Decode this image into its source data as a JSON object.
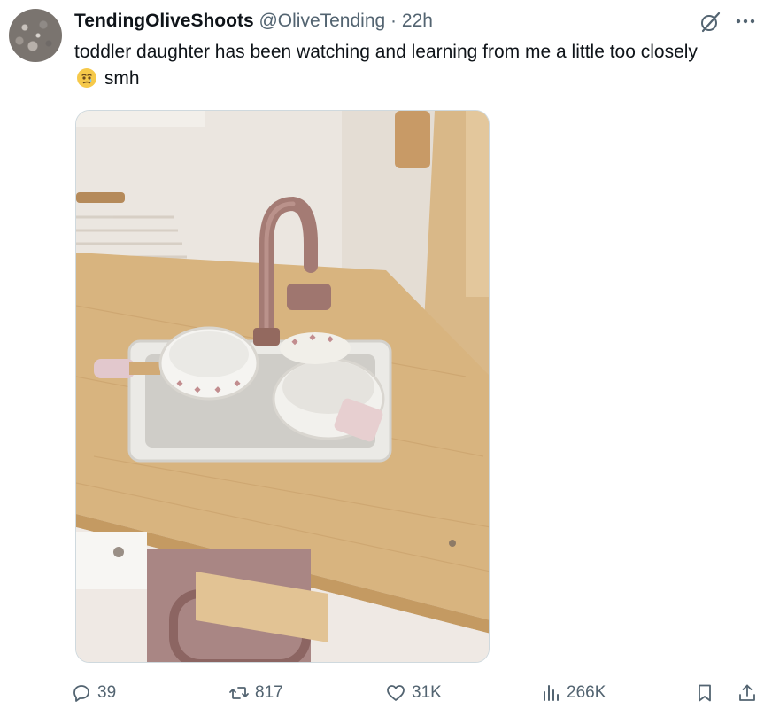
{
  "tweet": {
    "display_name": "TendingOliveShoots",
    "handle": "@OliveTending",
    "separator": "·",
    "time": "22h",
    "text_before_emoji": "toddler daughter has been watching and learning from me a little too closely",
    "text_after_emoji": "smh",
    "emoji": "face-holding-back-tears-icon"
  },
  "media": {
    "description_icon": "photo",
    "colors": {
      "wall": "#e7e1da",
      "wood": "#d7b17d",
      "faucet": "#a9817a",
      "sink": "#e9e8e4"
    }
  },
  "actions": {
    "replies": "39",
    "reposts": "817",
    "likes": "31K",
    "views": "266K"
  },
  "colors": {
    "text": "#0f1419",
    "muted": "#536471",
    "border": "#cfd9de"
  }
}
